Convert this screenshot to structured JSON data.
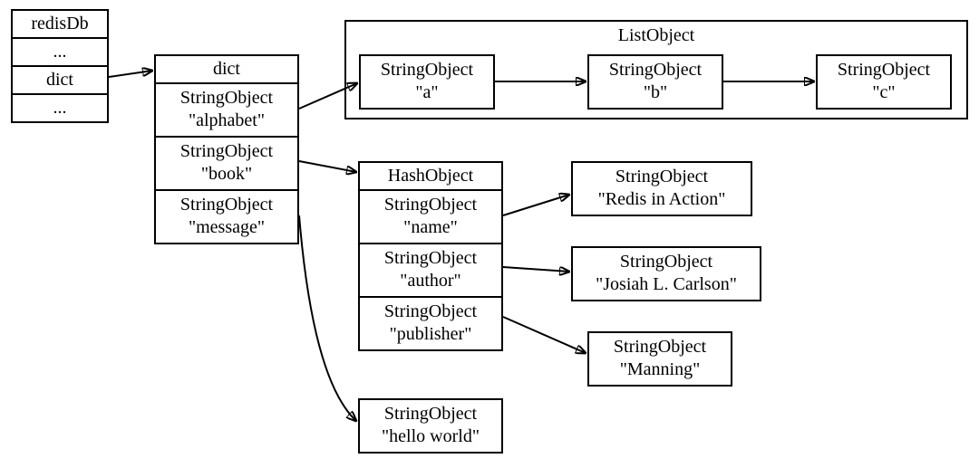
{
  "redisDb": {
    "title": "redisDb",
    "row1": "...",
    "row2": "dict",
    "row3": "..."
  },
  "dict": {
    "title": "dict",
    "k0_type": "StringObject",
    "k0_val": "\"alphabet\"",
    "k1_type": "StringObject",
    "k1_val": "\"book\"",
    "k2_type": "StringObject",
    "k2_val": "\"message\""
  },
  "listObject": {
    "label": "ListObject",
    "item0_type": "StringObject",
    "item0_val": "\"a\"",
    "item1_type": "StringObject",
    "item1_val": "\"b\"",
    "item2_type": "StringObject",
    "item2_val": "\"c\""
  },
  "hashObject": {
    "title": "HashObject",
    "k0_type": "StringObject",
    "k0_val": "\"name\"",
    "k1_type": "StringObject",
    "k1_val": "\"author\"",
    "k2_type": "StringObject",
    "k2_val": "\"publisher\""
  },
  "values": {
    "name_type": "StringObject",
    "name_val": "\"Redis in Action\"",
    "author_type": "StringObject",
    "author_val": "\"Josiah L. Carlson\"",
    "publisher_type": "StringObject",
    "publisher_val": "\"Manning\"",
    "message_type": "StringObject",
    "message_val": "\"hello world\""
  }
}
